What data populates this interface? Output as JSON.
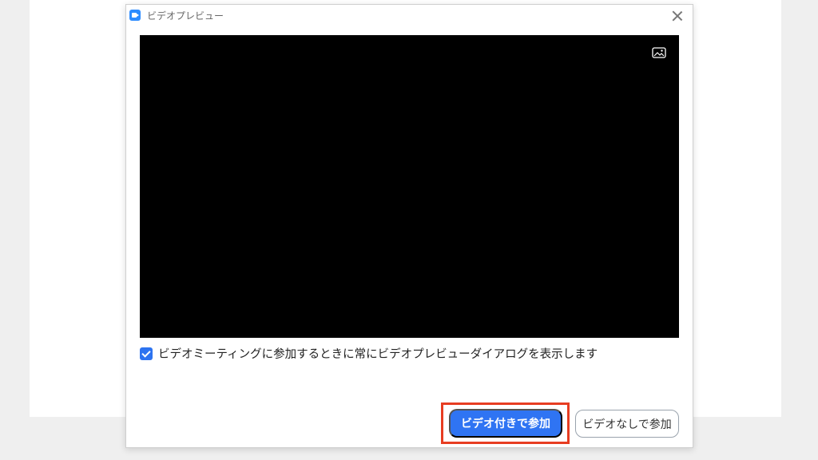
{
  "window": {
    "title": "ビデオプレビュー"
  },
  "preview": {
    "background_icon_name": "image-icon"
  },
  "option": {
    "checked": true,
    "label": "ビデオミーティングに参加するときに常にビデオプレビューダイアログを表示します"
  },
  "buttons": {
    "join_with_video": "ビデオ付きで参加",
    "join_without_video": "ビデオなしで参加"
  },
  "colors": {
    "accent": "#2f74f3",
    "highlight": "#e73d22",
    "preview_background": "#000000"
  }
}
